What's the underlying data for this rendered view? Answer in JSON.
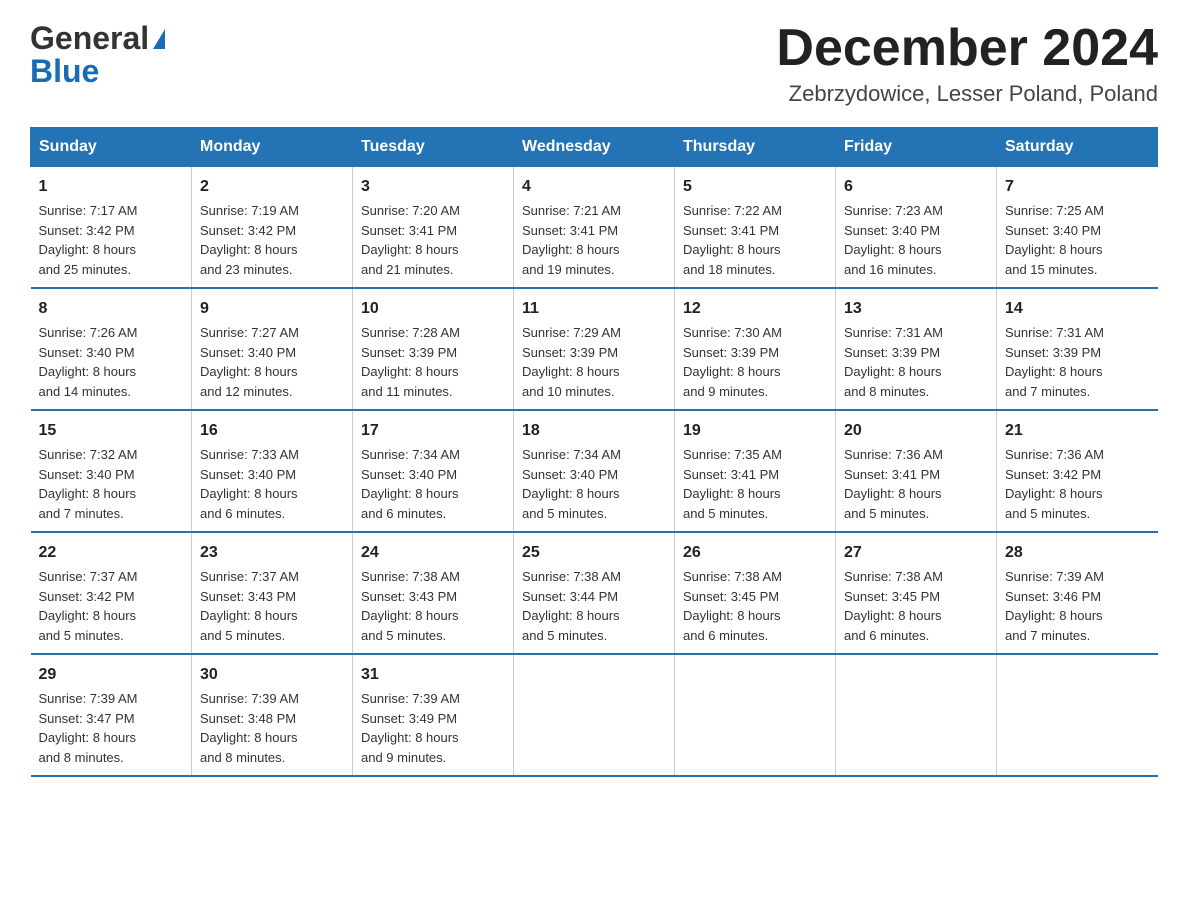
{
  "header": {
    "logo_line1": "General",
    "logo_line2": "Blue",
    "month_title": "December 2024",
    "location": "Zebrzydowice, Lesser Poland, Poland"
  },
  "weekdays": [
    "Sunday",
    "Monday",
    "Tuesday",
    "Wednesday",
    "Thursday",
    "Friday",
    "Saturday"
  ],
  "weeks": [
    [
      {
        "day": "1",
        "info": "Sunrise: 7:17 AM\nSunset: 3:42 PM\nDaylight: 8 hours\nand 25 minutes."
      },
      {
        "day": "2",
        "info": "Sunrise: 7:19 AM\nSunset: 3:42 PM\nDaylight: 8 hours\nand 23 minutes."
      },
      {
        "day": "3",
        "info": "Sunrise: 7:20 AM\nSunset: 3:41 PM\nDaylight: 8 hours\nand 21 minutes."
      },
      {
        "day": "4",
        "info": "Sunrise: 7:21 AM\nSunset: 3:41 PM\nDaylight: 8 hours\nand 19 minutes."
      },
      {
        "day": "5",
        "info": "Sunrise: 7:22 AM\nSunset: 3:41 PM\nDaylight: 8 hours\nand 18 minutes."
      },
      {
        "day": "6",
        "info": "Sunrise: 7:23 AM\nSunset: 3:40 PM\nDaylight: 8 hours\nand 16 minutes."
      },
      {
        "day": "7",
        "info": "Sunrise: 7:25 AM\nSunset: 3:40 PM\nDaylight: 8 hours\nand 15 minutes."
      }
    ],
    [
      {
        "day": "8",
        "info": "Sunrise: 7:26 AM\nSunset: 3:40 PM\nDaylight: 8 hours\nand 14 minutes."
      },
      {
        "day": "9",
        "info": "Sunrise: 7:27 AM\nSunset: 3:40 PM\nDaylight: 8 hours\nand 12 minutes."
      },
      {
        "day": "10",
        "info": "Sunrise: 7:28 AM\nSunset: 3:39 PM\nDaylight: 8 hours\nand 11 minutes."
      },
      {
        "day": "11",
        "info": "Sunrise: 7:29 AM\nSunset: 3:39 PM\nDaylight: 8 hours\nand 10 minutes."
      },
      {
        "day": "12",
        "info": "Sunrise: 7:30 AM\nSunset: 3:39 PM\nDaylight: 8 hours\nand 9 minutes."
      },
      {
        "day": "13",
        "info": "Sunrise: 7:31 AM\nSunset: 3:39 PM\nDaylight: 8 hours\nand 8 minutes."
      },
      {
        "day": "14",
        "info": "Sunrise: 7:31 AM\nSunset: 3:39 PM\nDaylight: 8 hours\nand 7 minutes."
      }
    ],
    [
      {
        "day": "15",
        "info": "Sunrise: 7:32 AM\nSunset: 3:40 PM\nDaylight: 8 hours\nand 7 minutes."
      },
      {
        "day": "16",
        "info": "Sunrise: 7:33 AM\nSunset: 3:40 PM\nDaylight: 8 hours\nand 6 minutes."
      },
      {
        "day": "17",
        "info": "Sunrise: 7:34 AM\nSunset: 3:40 PM\nDaylight: 8 hours\nand 6 minutes."
      },
      {
        "day": "18",
        "info": "Sunrise: 7:34 AM\nSunset: 3:40 PM\nDaylight: 8 hours\nand 5 minutes."
      },
      {
        "day": "19",
        "info": "Sunrise: 7:35 AM\nSunset: 3:41 PM\nDaylight: 8 hours\nand 5 minutes."
      },
      {
        "day": "20",
        "info": "Sunrise: 7:36 AM\nSunset: 3:41 PM\nDaylight: 8 hours\nand 5 minutes."
      },
      {
        "day": "21",
        "info": "Sunrise: 7:36 AM\nSunset: 3:42 PM\nDaylight: 8 hours\nand 5 minutes."
      }
    ],
    [
      {
        "day": "22",
        "info": "Sunrise: 7:37 AM\nSunset: 3:42 PM\nDaylight: 8 hours\nand 5 minutes."
      },
      {
        "day": "23",
        "info": "Sunrise: 7:37 AM\nSunset: 3:43 PM\nDaylight: 8 hours\nand 5 minutes."
      },
      {
        "day": "24",
        "info": "Sunrise: 7:38 AM\nSunset: 3:43 PM\nDaylight: 8 hours\nand 5 minutes."
      },
      {
        "day": "25",
        "info": "Sunrise: 7:38 AM\nSunset: 3:44 PM\nDaylight: 8 hours\nand 5 minutes."
      },
      {
        "day": "26",
        "info": "Sunrise: 7:38 AM\nSunset: 3:45 PM\nDaylight: 8 hours\nand 6 minutes."
      },
      {
        "day": "27",
        "info": "Sunrise: 7:38 AM\nSunset: 3:45 PM\nDaylight: 8 hours\nand 6 minutes."
      },
      {
        "day": "28",
        "info": "Sunrise: 7:39 AM\nSunset: 3:46 PM\nDaylight: 8 hours\nand 7 minutes."
      }
    ],
    [
      {
        "day": "29",
        "info": "Sunrise: 7:39 AM\nSunset: 3:47 PM\nDaylight: 8 hours\nand 8 minutes."
      },
      {
        "day": "30",
        "info": "Sunrise: 7:39 AM\nSunset: 3:48 PM\nDaylight: 8 hours\nand 8 minutes."
      },
      {
        "day": "31",
        "info": "Sunrise: 7:39 AM\nSunset: 3:49 PM\nDaylight: 8 hours\nand 9 minutes."
      },
      {
        "day": "",
        "info": ""
      },
      {
        "day": "",
        "info": ""
      },
      {
        "day": "",
        "info": ""
      },
      {
        "day": "",
        "info": ""
      }
    ]
  ]
}
